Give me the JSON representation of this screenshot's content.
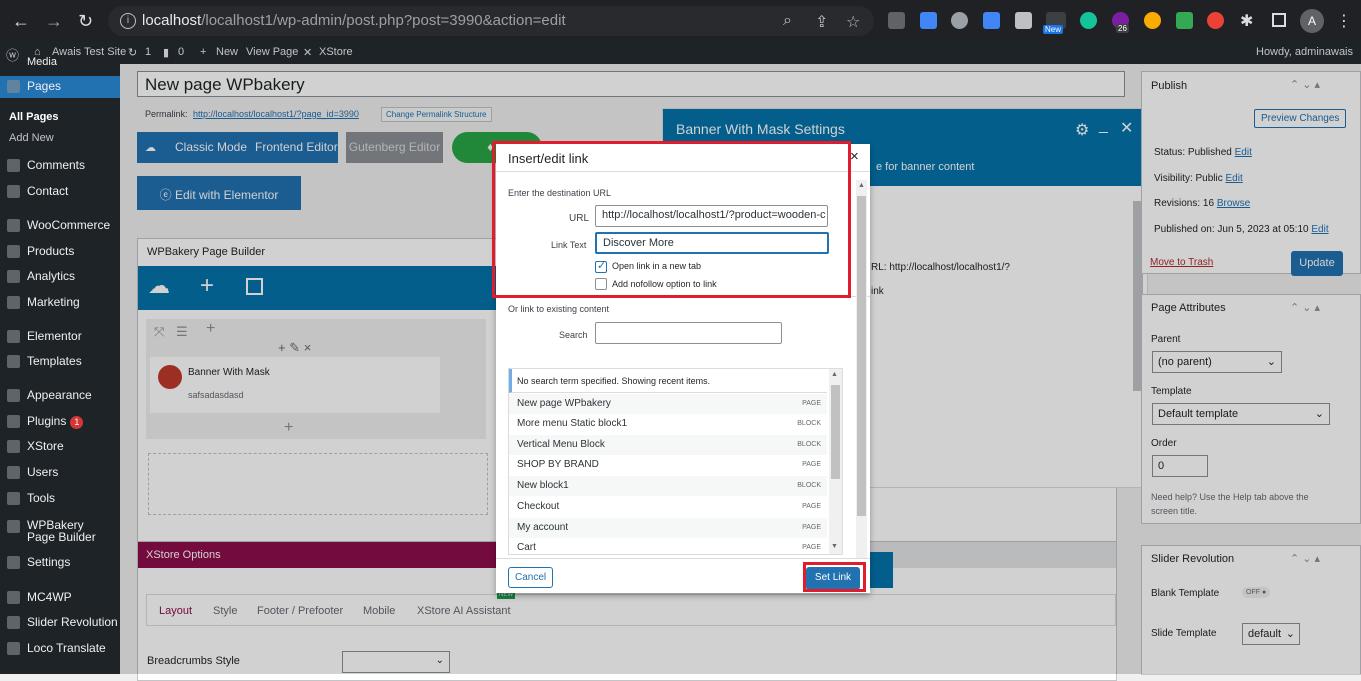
{
  "browser": {
    "url_host": "localhost",
    "url_path": "/localhost1/wp-admin/post.php?post=3990&action=edit",
    "profile_initial": "A",
    "ext_badge_new": "New",
    "ext_badge_count": "26"
  },
  "adminbar": {
    "site": "Awais Test Site",
    "updates": "1",
    "comments": "0",
    "new": "New",
    "view_page": "View Page",
    "xstore": "XStore",
    "howdy": "Howdy, adminawais"
  },
  "sidebar": {
    "media": "Media",
    "items": [
      {
        "label": "Pages",
        "current": true
      },
      {
        "label": "Comments"
      },
      {
        "label": "Contact"
      },
      {
        "label": "WooCommerce"
      },
      {
        "label": "Products"
      },
      {
        "label": "Analytics"
      },
      {
        "label": "Marketing"
      },
      {
        "label": "Elementor"
      },
      {
        "label": "Templates"
      },
      {
        "label": "Appearance"
      },
      {
        "label": "Plugins",
        "badge": "1"
      },
      {
        "label": "XStore"
      },
      {
        "label": "Users"
      },
      {
        "label": "Tools"
      },
      {
        "label": "WPBakery Page Builder"
      },
      {
        "label": "Settings"
      },
      {
        "label": "MC4WP"
      },
      {
        "label": "Slider Revolution"
      },
      {
        "label": "Loco Translate"
      }
    ],
    "sub_all_pages": "All Pages",
    "sub_add_new": "Add New"
  },
  "editor": {
    "title": "New page WPbakery",
    "permalink_label": "Permalink:",
    "permalink_url": "http://localhost/localhost1/?page_id=3990",
    "change_permalink": "Change Permalink Structure",
    "classic_mode": "Classic Mode",
    "frontend_editor": "Frontend Editor",
    "gutenberg_editor": "Gutenberg Editor",
    "insights_partial": "In",
    "edit_elementor": "Edit with Elementor",
    "wpb_title": "WPBakery Page Builder",
    "element_title": "Banner With Mask",
    "element_text": "safsadasdasd",
    "xstore_options": "XStore Options",
    "tabs": [
      "Layout",
      "Style",
      "Footer / Prefooter",
      "Mobile",
      "XStore AI Assistant"
    ],
    "tab_new_badge": "NEW",
    "breadcrumbs_label": "Breadcrumbs Style"
  },
  "banner_panel": {
    "title": "Banner With Mask Settings",
    "subtitle_partial": "e for banner content",
    "url_text": "RL: http://localhost/localhost1/?",
    "link_partial": "ink"
  },
  "publish": {
    "title": "Publish",
    "preview": "Preview Changes",
    "status": "Status: Published",
    "visibility": "Visibility: Public",
    "revisions": "Revisions: 16",
    "browse": "Browse",
    "published_on": "Published on: Jun 5, 2023 at 05:10",
    "edit": "Edit",
    "trash": "Move to Trash",
    "update": "Update"
  },
  "page_attributes": {
    "title": "Page Attributes",
    "parent_label": "Parent",
    "parent_value": "(no parent)",
    "template_label": "Template",
    "template_value": "Default template",
    "order_label": "Order",
    "order_value": "0",
    "help": "Need help? Use the Help tab above the screen title."
  },
  "slider_rev": {
    "title": "Slider Revolution",
    "blank_template": "Blank Template",
    "off": "OFF",
    "slide_template": "Slide Template",
    "slide_value": "default"
  },
  "modal": {
    "title": "Insert/edit link",
    "close": "×",
    "dest_label": "Enter the destination URL",
    "url_label": "URL",
    "url_value": "http://localhost/localhost1/?product=wooden-c",
    "text_label": "Link Text",
    "text_value": "Discover More",
    "newtab_label": "Open link in a new tab",
    "newtab_checked": true,
    "nofollow_label": "Add nofollow option to link",
    "nofollow_checked": false,
    "existing_label": "Or link to existing content",
    "search_label": "Search",
    "search_value": "",
    "results_notice": "No search term specified. Showing recent items.",
    "results": [
      {
        "title": "New page WPbakery",
        "type": "PAGE"
      },
      {
        "title": "More menu Static block1",
        "type": "BLOCK"
      },
      {
        "title": "Vertical Menu Block",
        "type": "BLOCK"
      },
      {
        "title": "SHOP BY BRAND",
        "type": "PAGE"
      },
      {
        "title": "New block1",
        "type": "BLOCK"
      },
      {
        "title": "Checkout",
        "type": "PAGE"
      },
      {
        "title": "My account",
        "type": "PAGE"
      },
      {
        "title": "Cart",
        "type": "PAGE"
      }
    ],
    "cancel": "Cancel",
    "set_link": "Set Link"
  }
}
